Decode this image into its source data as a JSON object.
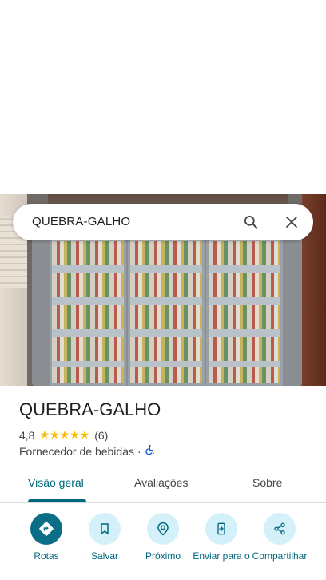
{
  "search": {
    "query": "QUEBRA-GALHO",
    "search_icon": "search-icon",
    "clear_icon": "close-icon"
  },
  "place": {
    "name": "QUEBRA-GALHO",
    "rating": "4,8",
    "rating_value": 4.8,
    "stars": "★★★★★",
    "review_count": "(6)",
    "category": "Fornecedor de bebidas",
    "separator": "·",
    "accessibility_icon": "wheelchair-icon"
  },
  "tabs": [
    {
      "label": "Visão geral",
      "active": true
    },
    {
      "label": "Avaliações",
      "active": false
    },
    {
      "label": "Sobre",
      "active": false
    }
  ],
  "actions": [
    {
      "label": "Rotas",
      "icon": "directions-icon"
    },
    {
      "label": "Salvar",
      "icon": "bookmark-icon"
    },
    {
      "label": "Próximo",
      "icon": "nearby-icon"
    },
    {
      "label": "Enviar para o",
      "icon": "send-to-phone-icon"
    },
    {
      "label": "Compartilhar",
      "icon": "share-icon"
    }
  ],
  "colors": {
    "accent": "#00677f",
    "primary_button": "#0b6e87",
    "action_bg": "#d4f1fa",
    "star": "#fbbc04"
  }
}
